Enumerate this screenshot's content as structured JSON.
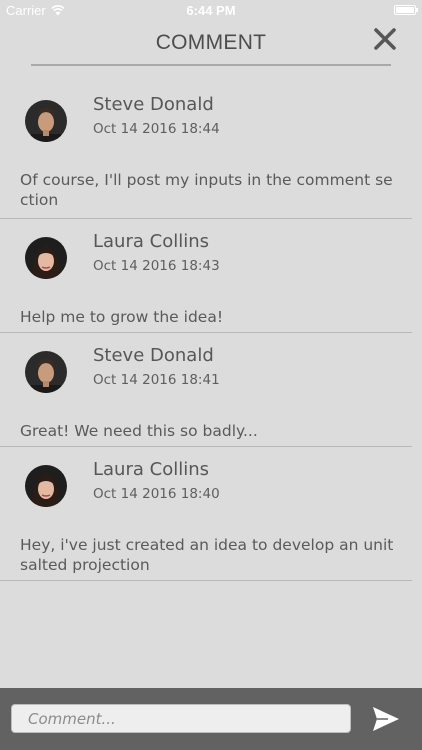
{
  "status_bar": {
    "carrier": "Carrier",
    "time": "6:44 PM",
    "wifi_icon": "wifi-icon",
    "battery_icon": "battery-icon"
  },
  "header": {
    "title": "COMMENT",
    "close_icon": "close-icon"
  },
  "comments": [
    {
      "author": "Steve Donald",
      "time": "Oct 14 2016 18:44",
      "text": "Of course, I'll post my inputs in the comment section",
      "avatar": "avatar-male"
    },
    {
      "author": "Laura Collins",
      "time": "Oct 14 2016 18:43",
      "text": "Help me to grow the idea!",
      "avatar": "avatar-female"
    },
    {
      "author": "Steve Donald",
      "time": "Oct 14 2016 18:41",
      "text": "Great! We need this so badly...",
      "avatar": "avatar-male"
    },
    {
      "author": "Laura Collins",
      "time": "Oct 14 2016 18:40",
      "text": "Hey, i've just created an idea to develop an unit salted projection",
      "avatar": "avatar-female"
    }
  ],
  "input_bar": {
    "placeholder": "Comment...",
    "value": "",
    "send_icon": "send-icon"
  },
  "colors": {
    "background": "#dcdcdc",
    "input_bar": "#626262",
    "text": "#5a5a5a"
  }
}
